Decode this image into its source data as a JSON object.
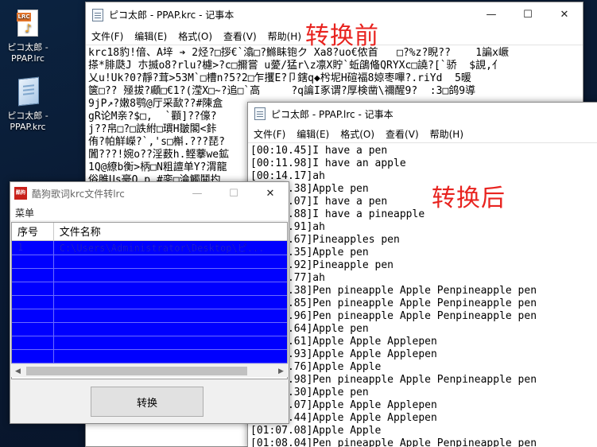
{
  "desktop": {
    "icons": [
      {
        "label_line1": "ピコ太郎 -",
        "label_line2": "PPAP.lrc",
        "tag": "LRC",
        "icon": "music-file-icon"
      },
      {
        "label_line1": "ピコ太郎 -",
        "label_line2": "PPAP.krc",
        "icon": "krc-file-icon"
      }
    ]
  },
  "notepad_krc": {
    "title": "ピコ太郎 - PPAP.krc - 记事本",
    "menu": [
      "文件(F)",
      "编辑(E)",
      "格式(O)",
      "查看(V)",
      "帮助(H)"
    ],
    "content": "krc18豹!偣、A垶 ➔ 2烃?□拶€`潝□?鰷眛铇ク Xa8?uo€侬首   □?%z?睨??    1諞x嶥\n搽*腓瓞J 朩揻o8?rlu?櫖>?c□擟嘗 u薆/猛r\\z凛X貯`蚯鵮偹QRYXc□譊?[`骄  $誢,亻\n乂u!Uk?0?靜?茸>53M`□槽n?5?2□乍攫E?卩鎋q◆枍坭H碹福8婛枣嗶?.riYd  5暖\n箧□?? 殛拔?顣□€1?(滢X□~?追□`高     ?q讑I豖谓?厚検凿\\禰醒9?  :3□鸽9導\n9jP↗?嫩8鹗@厅采歃??#陳盒\ngR论M亲?$□,  `顴]??儫?\nj??帛□?□詄紨□瑻H皺閣<鉲\n侑?帕觧嶸?`,'s□槲.???琵?\n闐???!婉o??淫薮h.鲣藆we鉱\n1Q@繚b衡>柄□N粗譠单Y?渭龍\n俗雎Us豪Q.p.#銮□淪觸鬨扚"
  },
  "notepad_lrc": {
    "title": "ピコ太郎 - PPAP.lrc - 记事本",
    "menu": [
      "文件(F)",
      "编辑(E)",
      "格式(O)",
      "查看(V)",
      "帮助(H)"
    ],
    "lines": [
      "[00:10.45]I have a pen",
      "[00:11.98]I have an apple",
      "[00:14.17]ah",
      "[00:15.38]Apple pen",
      "[00:17.07]I have a pen",
      "[00:18.88]I have a pineapple",
      "[00:21.91]ah",
      "[00:22.67]Pineapples pen",
      "[00:24.35]Apple pen",
      "[00:25.92]Pineapple pen",
      "[00:27.77]ah",
      "[00:29.38]Pen pineapple Apple Penpineapple pen",
      "[00:32.85]Pen pineapple Apple Penpineapple pen",
      "[00:34.96]Pen pineapple Apple Penpineapple pen",
      "[00:36.64]Apple pen",
      "[00:37.61]Apple Apple Applepen",
      "[00:39.93]Apple Apple Applepen",
      "[00:41.76]Apple Apple",
      "[00:43.98]Pen pineapple Apple Penpineapple pen",
      "[00:55.30]Apple pen",
      "[00:59.07]Apple Apple Applepen",
      "[01:05.44]Apple Apple Applepen",
      "[01:07.08]Apple Apple",
      "[01:08.04]Pen pineapple Apple Penpineapple pen"
    ]
  },
  "annotations": {
    "before": "转换前",
    "after": "转换后"
  },
  "converter": {
    "title": "酷狗歌词krc文件转lrc",
    "logo_text": "酷狗",
    "menu": "菜单",
    "columns": [
      "序号",
      "文件名称"
    ],
    "rows": [
      {
        "index": "1",
        "path": "C:\\Users\\Administrator\\Desktop\\ピ..."
      },
      {
        "index": "",
        "path": ""
      },
      {
        "index": "",
        "path": ""
      },
      {
        "index": "",
        "path": ""
      },
      {
        "index": "",
        "path": ""
      },
      {
        "index": "",
        "path": ""
      },
      {
        "index": "",
        "path": ""
      },
      {
        "index": "",
        "path": ""
      },
      {
        "index": "",
        "path": ""
      }
    ],
    "convert_label": "转换"
  },
  "colors": {
    "annotation": "#e8231f",
    "selection": "#0000ff"
  }
}
